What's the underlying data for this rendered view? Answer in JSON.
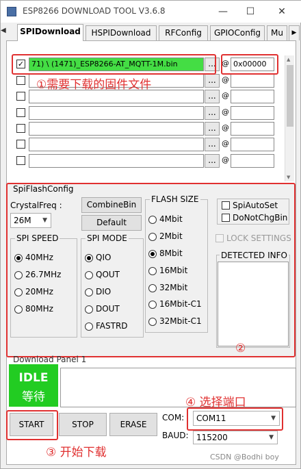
{
  "window": {
    "title": "ESP8266 DOWNLOAD TOOL V3.6.8",
    "minimize": "—",
    "maximize": "☐",
    "close": "✕"
  },
  "tabs": [
    {
      "label": "SPIDownload",
      "active": true
    },
    {
      "label": "HSPIDownload",
      "active": false
    },
    {
      "label": "RFConfig",
      "active": false
    },
    {
      "label": "GPIOConfig",
      "active": false
    },
    {
      "label": "Mu",
      "active": false
    }
  ],
  "files": [
    {
      "checked": true,
      "path": "71) \\ (1471)_ESP8266-AT_MQTT-1M.bin",
      "browse": "...",
      "at": "@",
      "address": "0x00000"
    },
    {
      "checked": false,
      "path": "",
      "browse": "...",
      "at": "@",
      "address": ""
    },
    {
      "checked": false,
      "path": "",
      "browse": "...",
      "at": "@",
      "address": ""
    },
    {
      "checked": false,
      "path": "",
      "browse": "...",
      "at": "@",
      "address": ""
    },
    {
      "checked": false,
      "path": "",
      "browse": "...",
      "at": "@",
      "address": ""
    },
    {
      "checked": false,
      "path": "",
      "browse": "...",
      "at": "@",
      "address": ""
    },
    {
      "checked": false,
      "path": "",
      "browse": "...",
      "at": "@",
      "address": ""
    }
  ],
  "annotations": {
    "a1": "①需要下载的固件文件",
    "a2": "②",
    "a3": "③ 开始下载",
    "a4": "④ 选择端口"
  },
  "config": {
    "title": "SpiFlashConfig",
    "crystal_label": "CrystalFreq :",
    "crystal_value": "26M",
    "combine_bin": "CombineBin",
    "default": "Default",
    "spi_speed": {
      "label": "SPI SPEED",
      "options": [
        {
          "label": "40MHz",
          "selected": true
        },
        {
          "label": "26.7MHz",
          "selected": false
        },
        {
          "label": "20MHz",
          "selected": false
        },
        {
          "label": "80MHz",
          "selected": false
        }
      ]
    },
    "spi_mode": {
      "label": "SPI MODE",
      "options": [
        {
          "label": "QIO",
          "selected": true
        },
        {
          "label": "QOUT",
          "selected": false
        },
        {
          "label": "DIO",
          "selected": false
        },
        {
          "label": "DOUT",
          "selected": false
        },
        {
          "label": "FASTRD",
          "selected": false
        }
      ]
    },
    "flash_size": {
      "label": "FLASH SIZE",
      "options": [
        {
          "label": "4Mbit",
          "selected": false
        },
        {
          "label": "2Mbit",
          "selected": false
        },
        {
          "label": "8Mbit",
          "selected": true
        },
        {
          "label": "16Mbit",
          "selected": false
        },
        {
          "label": "32Mbit",
          "selected": false
        },
        {
          "label": "16Mbit-C1",
          "selected": false
        },
        {
          "label": "32Mbit-C1",
          "selected": false
        }
      ]
    },
    "spi_auto_set": "SpiAutoSet",
    "do_not_chg_bin": "DoNotChgBin",
    "lock_settings": "LOCK SETTINGS",
    "detected_info": "DETECTED INFO"
  },
  "download_panel": {
    "title": "Download Panel 1",
    "status_en": "IDLE",
    "status_cn": "等待",
    "status_color": "#22cc22"
  },
  "controls": {
    "start": "START",
    "stop": "STOP",
    "erase": "ERASE",
    "com_label": "COM:",
    "com_value": "COM11",
    "baud_label": "BAUD:",
    "baud_value": "115200"
  },
  "watermark": "CSDN @Bodhi boy",
  "colors": {
    "annotation": "#e03030",
    "file_highlight": "#44dd44"
  }
}
